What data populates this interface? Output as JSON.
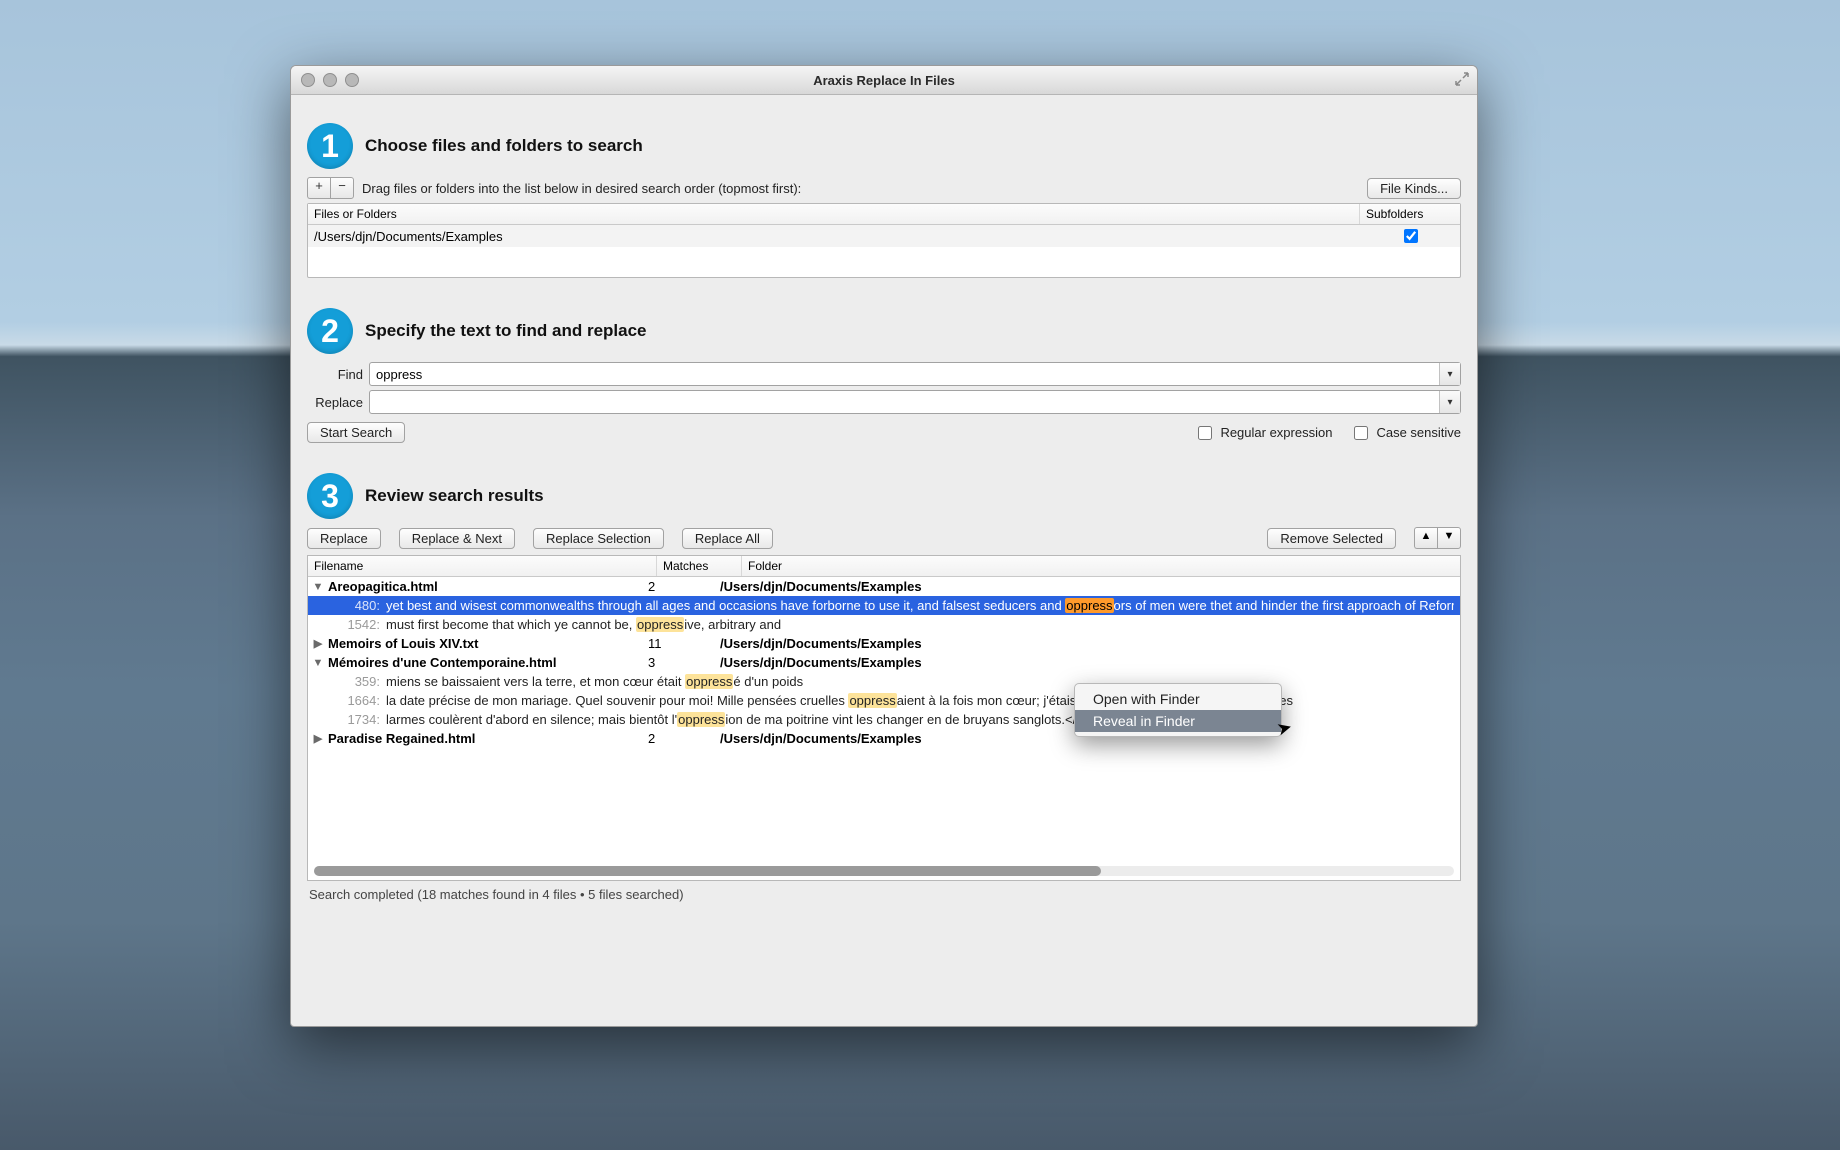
{
  "window": {
    "title": "Araxis Replace In Files"
  },
  "step1": {
    "num": "1",
    "title": "Choose files and folders to search",
    "hint": "Drag files or folders into the list below in desired search order (topmost first):",
    "file_kinds_label": "File Kinds...",
    "table": {
      "col_path": "Files or Folders",
      "col_sub": "Subfolders",
      "rows": [
        {
          "path": "/Users/djn/Documents/Examples",
          "subfolders": true
        }
      ]
    }
  },
  "step2": {
    "num": "2",
    "title": "Specify the text to find and replace",
    "find_label": "Find",
    "replace_label": "Replace",
    "find_value": "oppress",
    "replace_value": "",
    "start_search_label": "Start Search",
    "regex_label": "Regular expression",
    "case_label": "Case sensitive",
    "regex_checked": false,
    "case_checked": false
  },
  "step3": {
    "num": "3",
    "title": "Review search results",
    "btn_replace": "Replace",
    "btn_replace_next": "Replace & Next",
    "btn_replace_sel": "Replace Selection",
    "btn_replace_all": "Replace All",
    "btn_remove_sel": "Remove Selected",
    "col_file": "Filename",
    "col_matches": "Matches",
    "col_folder": "Folder"
  },
  "results": [
    {
      "filename": "Areopagitica.html",
      "matches": "2",
      "folder": "/Users/djn/Documents/Examples",
      "expanded": true,
      "lines": [
        {
          "line": "480",
          "pre": "yet best and wisest commonwealths through all ages and occasions have forborne to use it, and falsest seducers and ",
          "hit": "oppress",
          "post": "ors of men were thet and hinder the first approach of Reformation; I am of those who believe it will be a harder alch",
          "selected": true
        },
        {
          "line": "1542",
          "pre": "must first become that which ye cannot be, ",
          "hit": "oppress",
          "post": "ive, arbitrary and",
          "selected": false
        }
      ]
    },
    {
      "filename": "Memoirs of Louis XIV.txt",
      "matches": "11",
      "folder": "/Users/djn/Documents/Examples",
      "expanded": false,
      "lines": []
    },
    {
      "filename": "Mémoires d'une Contemporaine.html",
      "matches": "3",
      "folder": "/Users/djn/Documents/Examples",
      "expanded": true,
      "lines": [
        {
          "line": "359",
          "pre": "miens se baissaient vers la terre, et mon cœur était ",
          "hit": "oppress",
          "post": "é d'un poids",
          "selected": false
        },
        {
          "line": "1664",
          "pre": "la date précise de mon mariage. Quel souvenir pour moi! Mille pensées cruelles ",
          "hit": "oppress",
          "post": "aient à la fois mon cœur; j'étais comme enchaînée à la persaient des",
          "selected": false
        },
        {
          "line": "1734",
          "pre": "larmes coulèrent d'abord en silence; mais bientôt l'",
          "hit": "oppress",
          "post": "ion de ma poitrine vint les changer en de bruyans sanglots.</p>",
          "selected": false
        }
      ]
    },
    {
      "filename": "Paradise Regained.html",
      "matches": "2",
      "folder": "/Users/djn/Documents/Examples",
      "expanded": false,
      "lines": []
    }
  ],
  "context_menu": {
    "items": [
      {
        "label": "Open with Finder",
        "selected": false
      },
      {
        "label": "Reveal in Finder",
        "selected": true
      }
    ]
  },
  "status": "Search completed (18 matches found in 4 files • 5 files searched)"
}
